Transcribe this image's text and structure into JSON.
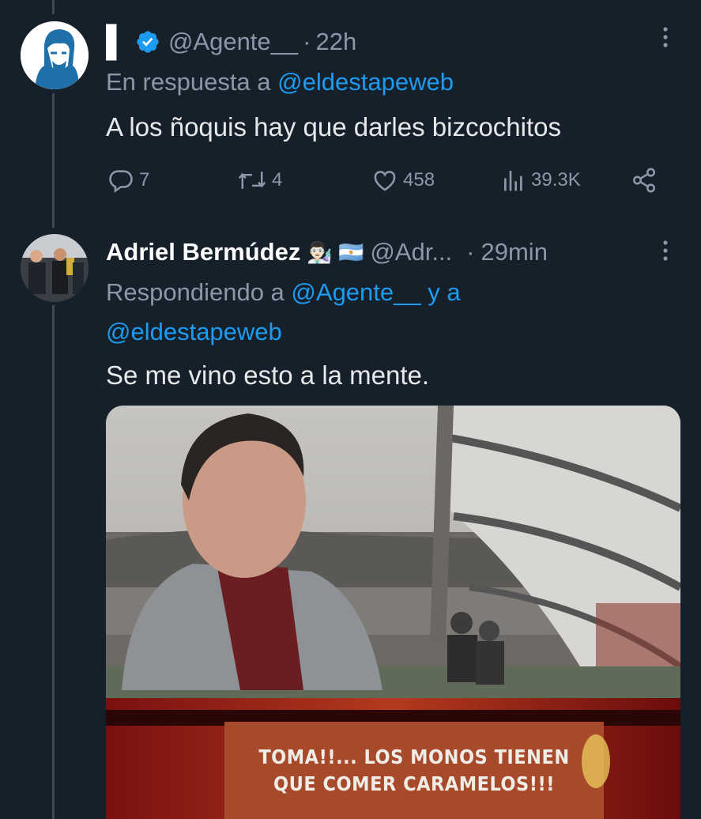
{
  "tweet1": {
    "display_name": "▌",
    "handle": "@Agente__",
    "separator": "·",
    "time": "22h",
    "reply_prefix": "En respuesta a",
    "reply_to": "@eldestapeweb",
    "text": "A los ñoquis hay que darles bizcochitos",
    "stats": {
      "replies": "7",
      "retweets": "4",
      "likes": "458",
      "views": "39.3K"
    },
    "verified": true
  },
  "tweet2": {
    "display_name": "Adriel Bermúdez",
    "emoji": "👨🏻‍🔬 🇦🇷",
    "handle": "@Adr...",
    "separator": "·",
    "time": "29min",
    "reply_prefix": "Respondiendo a",
    "reply_to_1": "@Agente__",
    "reply_conj": "y a",
    "reply_to_2": "@eldestapeweb",
    "text": "Se me vino esto a la mente.",
    "media_caption_1": "TOMA!!... LOS MONOS TIENEN",
    "media_caption_2": "QUE COMER CARAMELOS!!!"
  },
  "colors": {
    "background": "#15202b",
    "link": "#1d9bf0",
    "muted": "#8b98a5",
    "text": "#e7e9ea",
    "verified": "#1d9bf0"
  },
  "icons": [
    "more-icon",
    "verified-icon",
    "reply-icon",
    "retweet-icon",
    "like-icon",
    "views-icon",
    "share-icon"
  ]
}
